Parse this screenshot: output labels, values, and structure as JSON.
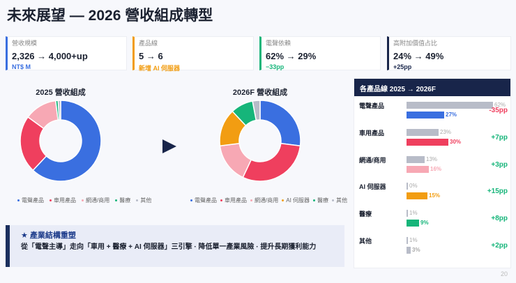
{
  "title": "未來展望 — 2026 營收組成轉型",
  "kpis": [
    {
      "label": "營收規模",
      "value": "2,326 → 4,000+up",
      "sub": "NT$ M",
      "color": "#3a6fe0"
    },
    {
      "label": "產品線",
      "value": "5 → 6",
      "sub": "新增 AI 伺服器",
      "color": "#f29d12"
    },
    {
      "label": "電聲依賴",
      "value": "62% → 29%",
      "sub": "−33pp",
      "color": "#16b57a"
    },
    {
      "label": "高附加價值占比",
      "value": "24% → 49%",
      "sub": "+25pp",
      "color": "#18254a"
    }
  ],
  "chart_data": [
    {
      "type": "pie",
      "title": "2025 營收組成",
      "categories": [
        "電聲產品",
        "車用產品",
        "網通/商用",
        "醫療",
        "其他"
      ],
      "values": [
        62,
        23,
        13,
        1,
        1
      ],
      "colors": [
        "#3a6fe0",
        "#ef3f5e",
        "#f7a8b4",
        "#16b57a",
        "#b8bcc8"
      ]
    },
    {
      "type": "pie",
      "title": "2026F 營收組成",
      "categories": [
        "電聲產品",
        "車用產品",
        "網通/商用",
        "AI 伺服器",
        "醫療",
        "其他"
      ],
      "values": [
        27,
        30,
        16,
        15,
        9,
        3
      ],
      "colors": [
        "#3a6fe0",
        "#ef3f5e",
        "#f7a8b4",
        "#f29d12",
        "#16b57a",
        "#b8bcc8"
      ]
    }
  ],
  "callout": {
    "heading": "★ 產業結構重塑",
    "text": "從「電聲主導」走向「車用 + 醫療 + AI 伺服器」三引擎 · 降低單一產業風險 · 提升長期獲利能力"
  },
  "panel": {
    "title": "各產品線 2025 → 2026F",
    "rows": [
      {
        "name": "電聲產品",
        "old": 62,
        "new": 27,
        "old_label": "62%",
        "new_label": "27%",
        "delta": "-35pp",
        "color": "#3a6fe0",
        "delta_color": "#ef3f5e"
      },
      {
        "name": "車用產品",
        "old": 23,
        "new": 30,
        "old_label": "23%",
        "new_label": "30%",
        "delta": "+7pp",
        "color": "#ef3f5e",
        "delta_color": "#16b57a"
      },
      {
        "name": "網通/商用",
        "old": 13,
        "new": 16,
        "old_label": "13%",
        "new_label": "16%",
        "delta": "+3pp",
        "color": "#f7a8b4",
        "delta_color": "#16b57a"
      },
      {
        "name": "AI 伺服器",
        "old": 0,
        "new": 15,
        "old_label": "0%",
        "new_label": "15%",
        "delta": "+15pp",
        "color": "#f29d12",
        "delta_color": "#16b57a"
      },
      {
        "name": "醫療",
        "old": 1,
        "new": 9,
        "old_label": "1%",
        "new_label": "9%",
        "delta": "+8pp",
        "color": "#16b57a",
        "delta_color": "#16b57a"
      },
      {
        "name": "其他",
        "old": 1,
        "new": 3,
        "old_label": "1%",
        "new_label": "3%",
        "delta": "+2pp",
        "color": "#b8bcc8",
        "delta_color": "#16b57a"
      }
    ]
  },
  "page_number": "20"
}
